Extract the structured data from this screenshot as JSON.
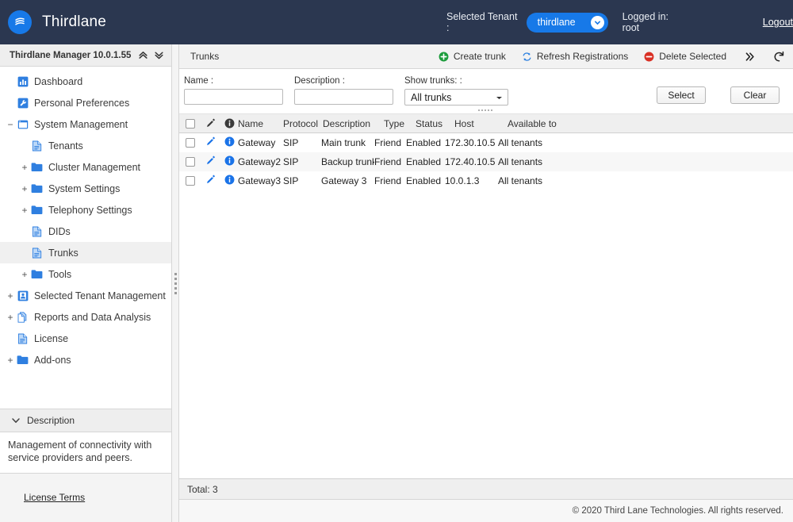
{
  "topbar": {
    "brand": "Thirdlane",
    "logo_icon": "thirdlane-logo-icon",
    "selected_tenant_label": "Selected Tenant :",
    "tenant_value": "thirdlane",
    "tenant_caret_icon": "chevron-down-icon",
    "logged_in": "Logged in: root",
    "logout": "Logout",
    "bg_color": "#2b3750",
    "accent_color": "#1779e8"
  },
  "sidebar": {
    "title": "Thirdlane Manager 10.0.1.55",
    "collapse_all_icon": "double-chevron-up-icon",
    "expand_all_icon": "double-chevron-down-icon",
    "items": [
      {
        "label": "Dashboard",
        "icon": "dashboard-icon",
        "indent": 0,
        "twisty": "",
        "selected": false
      },
      {
        "label": "Personal Preferences",
        "icon": "preferences-icon",
        "indent": 0,
        "twisty": "",
        "selected": false
      },
      {
        "label": "System Management",
        "icon": "window-icon",
        "indent": 0,
        "twisty": "minus",
        "selected": false
      },
      {
        "label": "Tenants",
        "icon": "document-icon",
        "indent": 1,
        "twisty": "",
        "selected": false
      },
      {
        "label": "Cluster Management",
        "icon": "folder-icon",
        "indent": 1,
        "twisty": "plus",
        "selected": false
      },
      {
        "label": "System Settings",
        "icon": "folder-icon",
        "indent": 1,
        "twisty": "plus",
        "selected": false
      },
      {
        "label": "Telephony Settings",
        "icon": "folder-icon",
        "indent": 1,
        "twisty": "plus",
        "selected": false
      },
      {
        "label": "DIDs",
        "icon": "document-icon",
        "indent": 1,
        "twisty": "",
        "selected": false
      },
      {
        "label": "Trunks",
        "icon": "document-icon",
        "indent": 1,
        "twisty": "",
        "selected": true
      },
      {
        "label": "Tools",
        "icon": "folder-icon",
        "indent": 1,
        "twisty": "plus",
        "selected": false
      },
      {
        "label": "Selected Tenant Management",
        "icon": "tenant-icon",
        "indent": 0,
        "twisty": "plus",
        "selected": false
      },
      {
        "label": "Reports and Data Analysis",
        "icon": "reports-icon",
        "indent": 0,
        "twisty": "plus",
        "selected": false
      },
      {
        "label": "License",
        "icon": "document-icon",
        "indent": 0,
        "twisty": "",
        "selected": false
      },
      {
        "label": "Add-ons",
        "icon": "folder-icon",
        "indent": 0,
        "twisty": "plus",
        "selected": false
      }
    ],
    "description_header": "Description",
    "description_caret_icon": "chevron-down-icon",
    "description_text": "Management of connectivity with service providers and peers.",
    "license_terms": "License Terms"
  },
  "main": {
    "toolbar": {
      "title": "Trunks",
      "create_trunk": "Create trunk",
      "create_trunk_icon": "plus-circle-icon",
      "refresh_registrations": "Refresh Registrations",
      "refresh_registrations_icon": "sync-icon",
      "delete_selected": "Delete Selected",
      "delete_selected_icon": "minus-circle-icon",
      "more_icon": "double-chevron-right-icon",
      "reload_icon": "reload-icon",
      "create_color": "#1c9c3c",
      "delete_color": "#d93025",
      "refresh_color": "#2a7fe0"
    },
    "filters": {
      "name_label": "Name :",
      "name_value": "",
      "description_label": "Description :",
      "description_value": "",
      "show_trunks_label": "Show trunks: :",
      "show_trunks_value": "All trunks",
      "show_trunks_caret_icon": "caret-down-icon",
      "select_button": "Select",
      "clear_button": "Clear"
    },
    "table": {
      "columns": [
        "",
        "",
        "",
        "Name",
        "Protocol",
        "Description",
        "Type",
        "Status",
        "Host",
        "Available to"
      ],
      "header_icons": {
        "edit": "pencil-icon",
        "info": "info-circle-icon"
      },
      "rows": [
        {
          "name": "Gateway",
          "protocol": "SIP",
          "description": "Main trunk",
          "type": "Friend",
          "status": "Enabled",
          "host": "172.30.10.5",
          "available_to": "All tenants",
          "checked": false
        },
        {
          "name": "Gateway2",
          "protocol": "SIP",
          "description": "Backup trunk",
          "type": "Friend",
          "status": "Enabled",
          "host": "172.40.10.5",
          "available_to": "All tenants",
          "checked": false
        },
        {
          "name": "Gateway3",
          "protocol": "SIP",
          "description": "Gateway 3",
          "type": "Friend",
          "status": "Enabled",
          "host": "10.0.1.3",
          "available_to": "All tenants",
          "checked": false
        }
      ],
      "total": "Total: 3"
    }
  },
  "footer": {
    "copyright": "© 2020 Third Lane Technologies. All rights reserved."
  }
}
